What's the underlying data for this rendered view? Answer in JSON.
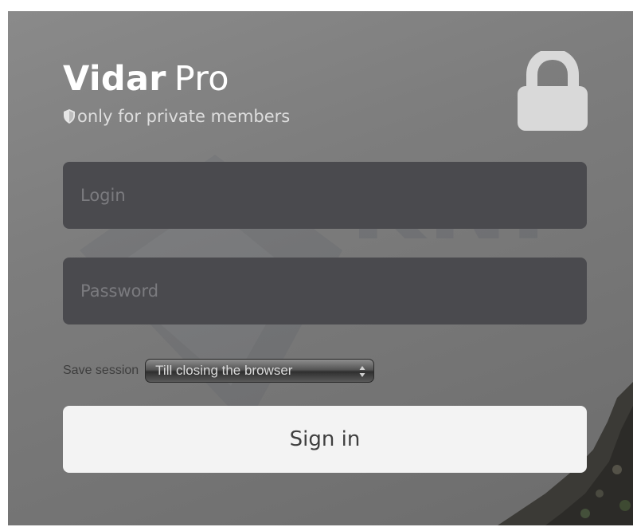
{
  "app": {
    "brand": "Vidar",
    "edition": "Pro",
    "subtitle": "only for private members"
  },
  "form": {
    "login_placeholder": "Login",
    "login_value": "",
    "password_placeholder": "Password",
    "password_value": "",
    "session_label": "Save session",
    "session_selected": "Till closing the browser",
    "signin_label": "Sign in"
  },
  "icons": {
    "lock": "lock-icon",
    "shield": "shield-icon",
    "select_arrows": "updown-arrows-icon"
  },
  "colors": {
    "background": "#7d7d7d",
    "field_background": "#4a4a4e",
    "button_background": "#f3f3f3",
    "text_light": "#ffffff"
  }
}
